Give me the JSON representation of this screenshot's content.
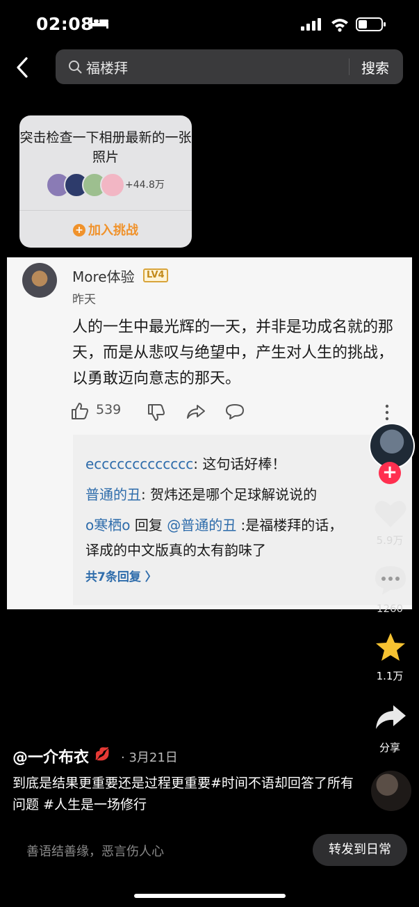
{
  "status": {
    "time": "02:08"
  },
  "search": {
    "query": "福楼拜",
    "button": "搜索"
  },
  "challenge": {
    "title": "突击检查一下相册最新的一张照片",
    "participants": "+44.8万",
    "join": "加入挑战",
    "avatar_colors": [
      "#8a7bb5",
      "#2d3b6b",
      "#9dbf8f",
      "#f2b6c4"
    ]
  },
  "comment": {
    "username": "More体验",
    "level": "LV4",
    "date": "昨天",
    "text": "人的一生中最光辉的一天，并非是功成名就的那天，而是从悲叹与绝望中，产生对人生的挑战，以勇敢迈向意志的那天。",
    "likes": "539",
    "replies": [
      {
        "user": "eccccccccccccc",
        "text": ": 这句话好棒！"
      },
      {
        "user": "普通的丑",
        "text": ": 贺炜还是哪个足球解说说的"
      },
      {
        "user": "o寒栖o",
        "reply_word": " 回复 ",
        "reply_to": "@普通的丑",
        "text": " :是福楼拜的话，",
        "text2": "译成的中文版真的太有韵味了"
      }
    ],
    "more_replies": "共7条回复 〉"
  },
  "rail": {
    "likes": "5.9万",
    "comments": "1260",
    "favorites": "1.1万",
    "share": "分享"
  },
  "post": {
    "author": "@一介布衣",
    "date": "· 3月21日",
    "description": "到底是结果更重要还是过程更重要#时间不语却回答了所有问题 #人生是一场修行"
  },
  "bottom": {
    "comment_placeholder": "善语结善缘，恶言伤人心",
    "repost": "转发到日常"
  },
  "colors": {
    "accent_orange": "#f0922b",
    "reply_blue": "#2e6cab",
    "follow_red": "#ff2f4f",
    "star_yellow": "#f6c231"
  }
}
